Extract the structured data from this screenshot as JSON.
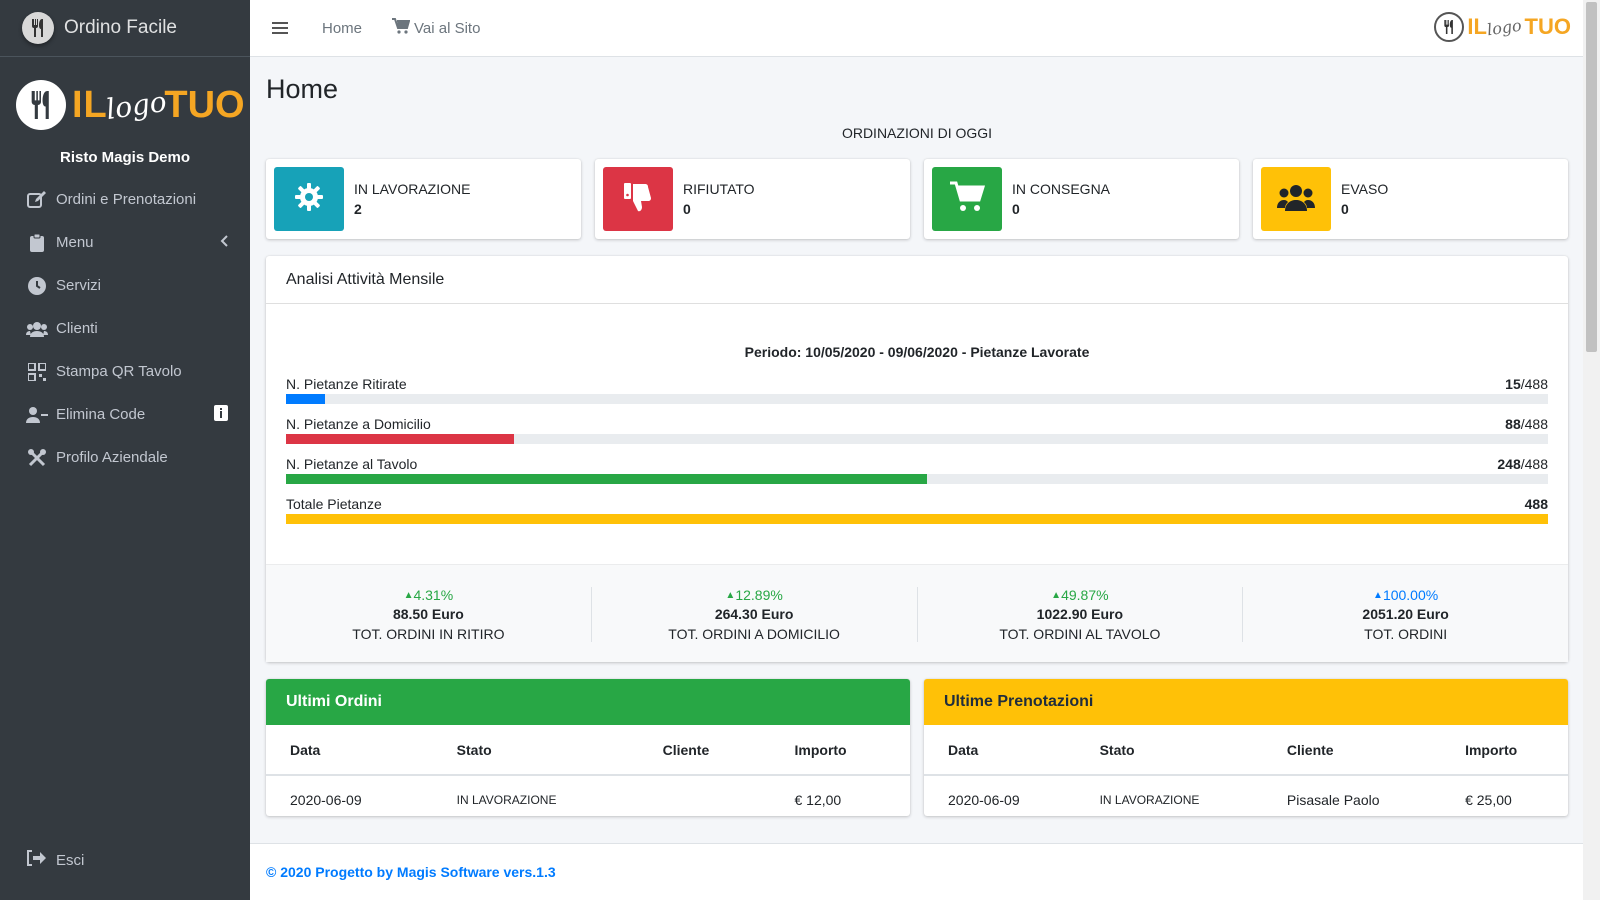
{
  "app": {
    "brand_name": "Ordino Facile",
    "logo": {
      "il": "IL",
      "script": "logo",
      "tuo": "TUO"
    },
    "user_name": "Risto Magis Demo"
  },
  "sidebar": {
    "items": [
      {
        "label": "Ordini e Prenotazioni",
        "icon": "edit-icon"
      },
      {
        "label": "Menu",
        "icon": "clipboard-icon"
      },
      {
        "label": "Servizi",
        "icon": "clock-icon"
      },
      {
        "label": "Clienti",
        "icon": "users-icon"
      },
      {
        "label": "Stampa QR Tavolo",
        "icon": "qrcode-icon"
      },
      {
        "label": "Elimina Code",
        "icon": "user-minus-icon"
      },
      {
        "label": "Profilo Aziendale",
        "icon": "tools-icon"
      }
    ],
    "logout_label": "Esci"
  },
  "topbar": {
    "home_label": "Home",
    "site_label": "Vai al Sito"
  },
  "page": {
    "title": "Home",
    "today_label": "ORDINAZIONI DI OGGI"
  },
  "info_boxes": [
    {
      "label": "IN LAVORAZIONE",
      "value": "2",
      "color": "#17a2b8",
      "icon": "gear-icon"
    },
    {
      "label": "RIFIUTATO",
      "value": "0",
      "color": "#dc3545",
      "icon": "thumbs-down-icon"
    },
    {
      "label": "IN CONSEGNA",
      "value": "0",
      "color": "#28a745",
      "icon": "cart-icon"
    },
    {
      "label": "EVASO",
      "value": "0",
      "color": "#ffc107",
      "icon": "users-icon"
    }
  ],
  "analysis": {
    "title": "Analisi Attività Mensile",
    "period": "Periodo: 10/05/2020 - 09/06/2020 - Pietanze Lavorate",
    "bars": [
      {
        "label": "N. Pietanze Ritirate",
        "value": "15",
        "total": "/488",
        "fraction": 0.0307,
        "color": "#007bff"
      },
      {
        "label": "N. Pietanze a Domicilio",
        "value": "88",
        "total": "/488",
        "fraction": 0.1803,
        "color": "#dc3545"
      },
      {
        "label": "N. Pietanze al Tavolo",
        "value": "248",
        "total": "/488",
        "fraction": 0.5082,
        "color": "#28a745"
      },
      {
        "label": "Totale Pietanze",
        "value": "488",
        "total": "",
        "fraction": 1.0,
        "color": "#ffc107"
      }
    ],
    "stats": [
      {
        "pct": "4.31%",
        "amount": "88.50 Euro",
        "label": "TOT. ORDINI IN RITIRO",
        "color": "#28a745"
      },
      {
        "pct": "12.89%",
        "amount": "264.30 Euro",
        "label": "TOT. ORDINI A DOMICILIO",
        "color": "#28a745"
      },
      {
        "pct": "49.87%",
        "amount": "1022.90 Euro",
        "label": "TOT. ORDINI AL TAVOLO",
        "color": "#28a745"
      },
      {
        "pct": "100.00%",
        "amount": "2051.20 Euro",
        "label": "TOT. ORDINI",
        "color": "#007bff"
      }
    ]
  },
  "orders": {
    "title": "Ultimi Ordini",
    "color": "#28a745",
    "columns": [
      "Data",
      "Stato",
      "Cliente",
      "Importo"
    ],
    "rows": [
      {
        "data": "2020-06-09",
        "stato": "IN LAVORAZIONE",
        "cliente": "",
        "importo": "€ 12,00"
      }
    ]
  },
  "bookings": {
    "title": "Ultime Prenotazioni",
    "color": "#ffc107",
    "columns": [
      "Data",
      "Stato",
      "Cliente",
      "Importo"
    ],
    "rows": [
      {
        "data": "2020-06-09",
        "stato": "IN LAVORAZIONE",
        "cliente": "Pisasale Paolo",
        "importo": "€ 25,00"
      }
    ]
  },
  "footer": {
    "text": "© 2020 Progetto by Magis Software vers.1.3"
  }
}
